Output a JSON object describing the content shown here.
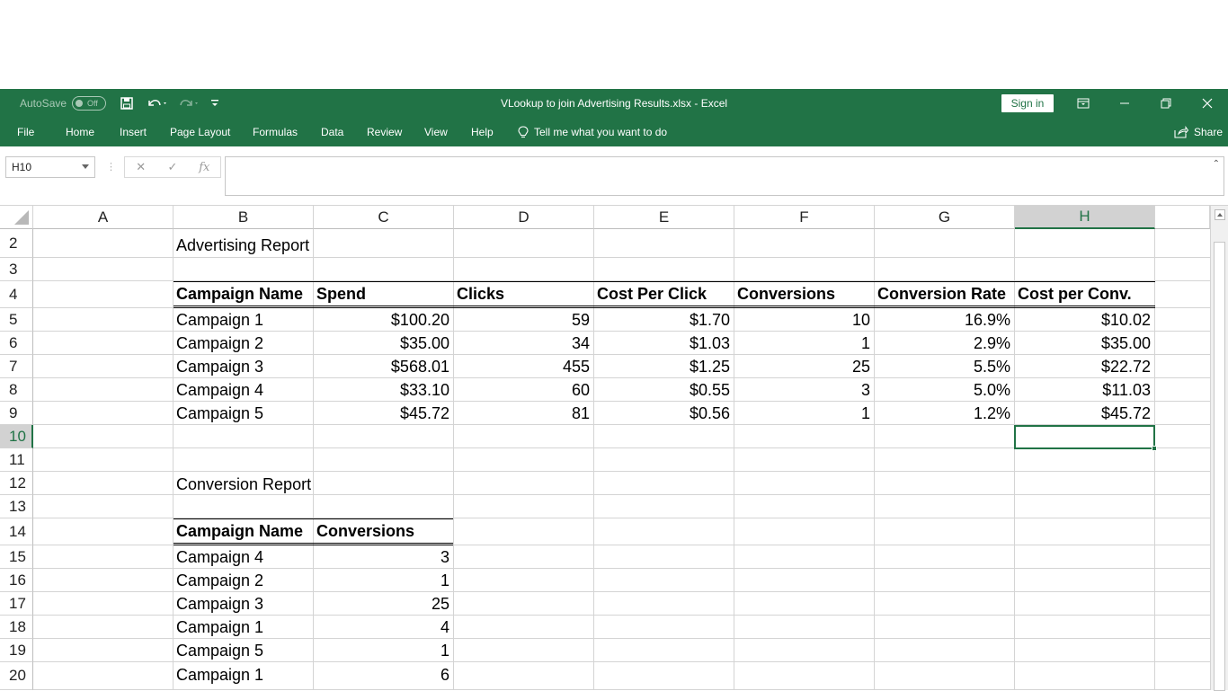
{
  "titlebar": {
    "autosave_label": "AutoSave",
    "autosave_state": "Off",
    "title": "VLookup to join Advertising Results.xlsx  -  Excel",
    "signin_label": "Sign in"
  },
  "ribbon": {
    "tabs": [
      "File",
      "Home",
      "Insert",
      "Page Layout",
      "Formulas",
      "Data",
      "Review",
      "View",
      "Help"
    ],
    "tell_me": "Tell me what you want to do",
    "share": "Share"
  },
  "formula_bar": {
    "name_box": "H10",
    "formula": ""
  },
  "columns": [
    "A",
    "B",
    "C",
    "D",
    "E",
    "F",
    "G",
    "H"
  ],
  "selected_column": "H",
  "rows": [
    "2",
    "3",
    "4",
    "5",
    "6",
    "7",
    "8",
    "9",
    "10",
    "11",
    "12",
    "13",
    "14",
    "15",
    "16",
    "17",
    "18",
    "19",
    "20"
  ],
  "selected_row": "10",
  "advertising_report": {
    "title": "Advertising Report",
    "headers": [
      "Campaign Name",
      "Spend",
      "Clicks",
      "Cost Per Click",
      "Conversions",
      "Conversion Rate",
      "Cost per Conv."
    ],
    "rows": [
      [
        "Campaign 1",
        "$100.20",
        "59",
        "$1.70",
        "10",
        "16.9%",
        "$10.02"
      ],
      [
        "Campaign 2",
        "$35.00",
        "34",
        "$1.03",
        "1",
        "2.9%",
        "$35.00"
      ],
      [
        "Campaign 3",
        "$568.01",
        "455",
        "$1.25",
        "25",
        "5.5%",
        "$22.72"
      ],
      [
        "Campaign 4",
        "$33.10",
        "60",
        "$0.55",
        "3",
        "5.0%",
        "$11.03"
      ],
      [
        "Campaign 5",
        "$45.72",
        "81",
        "$0.56",
        "1",
        "1.2%",
        "$45.72"
      ]
    ]
  },
  "conversion_report": {
    "title": "Conversion Report",
    "headers": [
      "Campaign Name",
      "Conversions"
    ],
    "rows": [
      [
        "Campaign 4",
        "3"
      ],
      [
        "Campaign 2",
        "1"
      ],
      [
        "Campaign 3",
        "25"
      ],
      [
        "Campaign 1",
        "4"
      ],
      [
        "Campaign 5",
        "1"
      ],
      [
        "Campaign 1",
        "6"
      ]
    ]
  }
}
